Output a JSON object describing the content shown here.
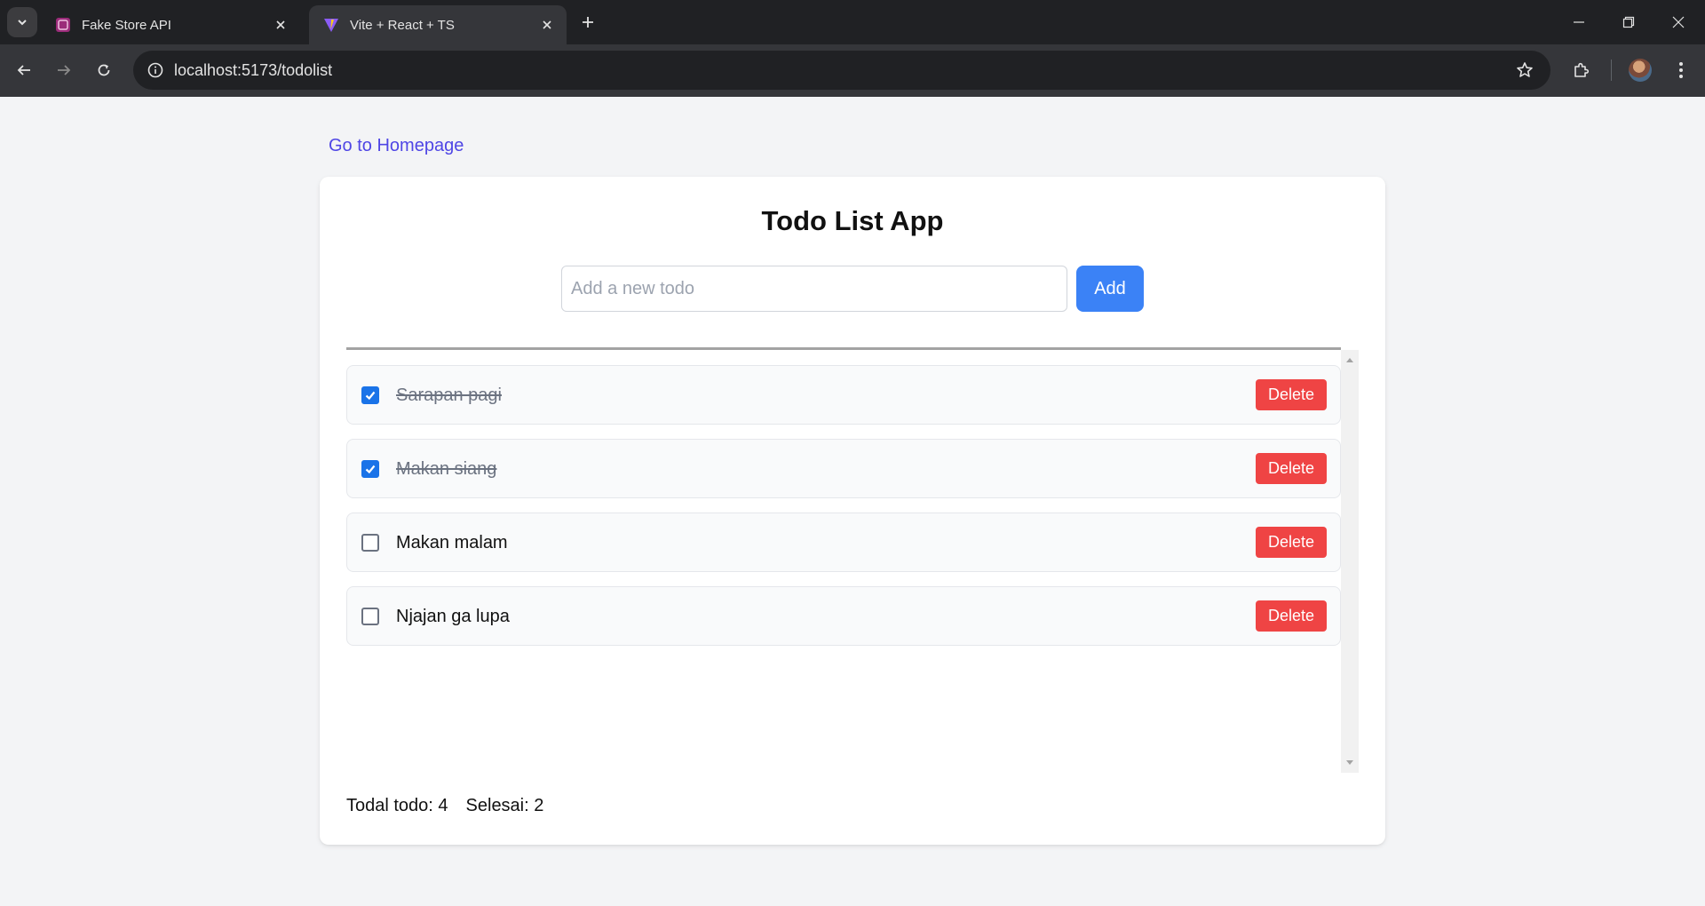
{
  "browser": {
    "tabs": [
      {
        "title": "Fake Store API",
        "favicon": "fakestore-favicon-icon",
        "active": false
      },
      {
        "title": "Vite + React + TS",
        "favicon": "vite-favicon-icon",
        "active": true
      }
    ],
    "url": "localhost:5173/todolist"
  },
  "page": {
    "home_link": "Go to Homepage",
    "title": "Todo List App",
    "input": {
      "placeholder": "Add a new todo",
      "value": ""
    },
    "add_label": "Add",
    "todos": [
      {
        "text": "Sarapan pagi",
        "done": true,
        "delete_label": "Delete"
      },
      {
        "text": "Makan siang",
        "done": true,
        "delete_label": "Delete"
      },
      {
        "text": "Makan malam",
        "done": false,
        "delete_label": "Delete"
      },
      {
        "text": "Njajan ga lupa",
        "done": false,
        "delete_label": "Delete"
      }
    ],
    "stats": {
      "total": "Todal todo: 4",
      "done": "Selesai: 2"
    }
  },
  "colors": {
    "link": "#4f46e5",
    "add_button": "#3b82f6",
    "delete_button": "#ef4444",
    "checkbox_checked": "#1a73e8"
  }
}
